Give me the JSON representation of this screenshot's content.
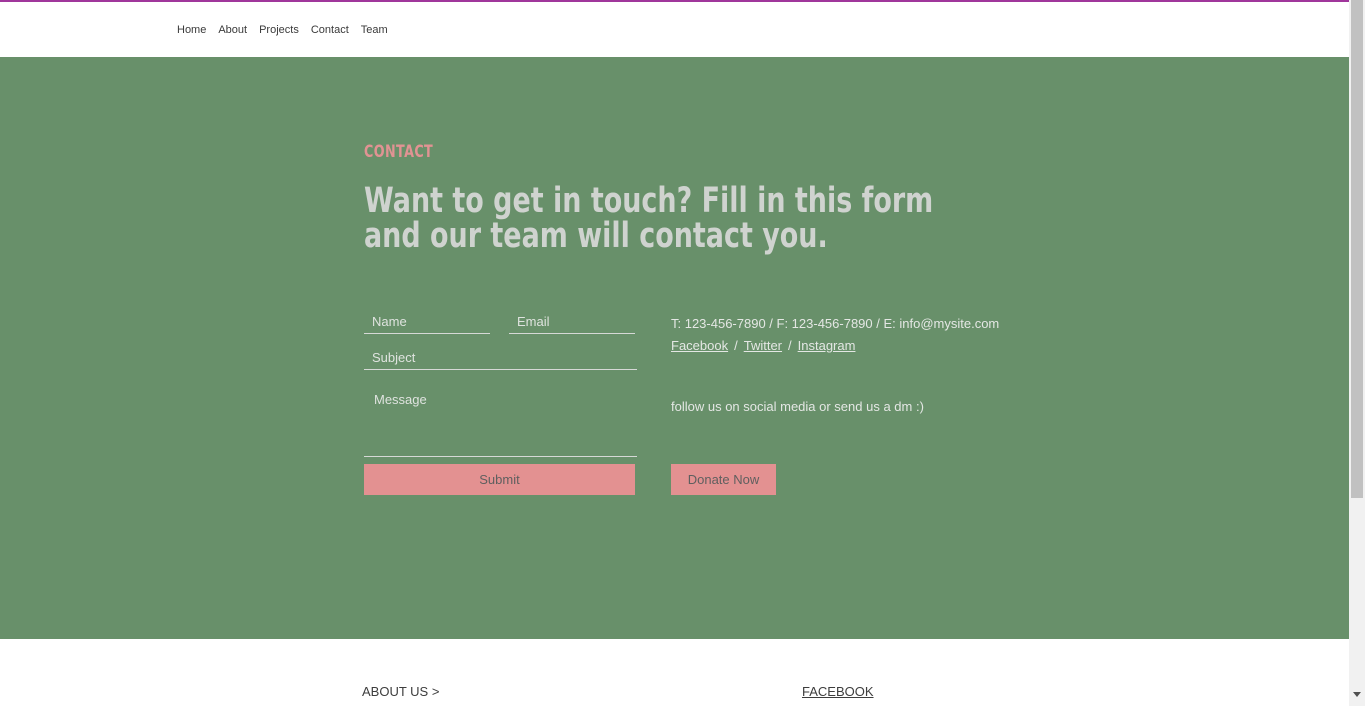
{
  "nav": {
    "items": [
      {
        "label": "Home"
      },
      {
        "label": "About"
      },
      {
        "label": "Projects"
      },
      {
        "label": "Contact"
      },
      {
        "label": "Team"
      }
    ]
  },
  "contact": {
    "label": "CONTACT",
    "headline": "Want to get in touch? Fill in this form and our team will contact you."
  },
  "form": {
    "name_placeholder": "Name",
    "email_placeholder": "Email",
    "subject_placeholder": "Subject",
    "message_placeholder": "Message",
    "submit_label": "Submit"
  },
  "info": {
    "contact_line": "T: 123-456-7890 / F: 123-456-7890 / E: info@mysite.com",
    "social": [
      {
        "label": "Facebook"
      },
      {
        "label": "Twitter"
      },
      {
        "label": "Instagram"
      }
    ],
    "separator": "/",
    "follow_text": "follow us on social media or send us a dm :)",
    "donate_label": "Donate Now"
  },
  "footer": {
    "about_label": "ABOUT US >",
    "facebook_label": "FACEBOOK"
  },
  "colors": {
    "accent_line": "#a0369b",
    "section_bg": "#68906a",
    "button_bg": "#e39191",
    "label_color": "#e19393"
  }
}
